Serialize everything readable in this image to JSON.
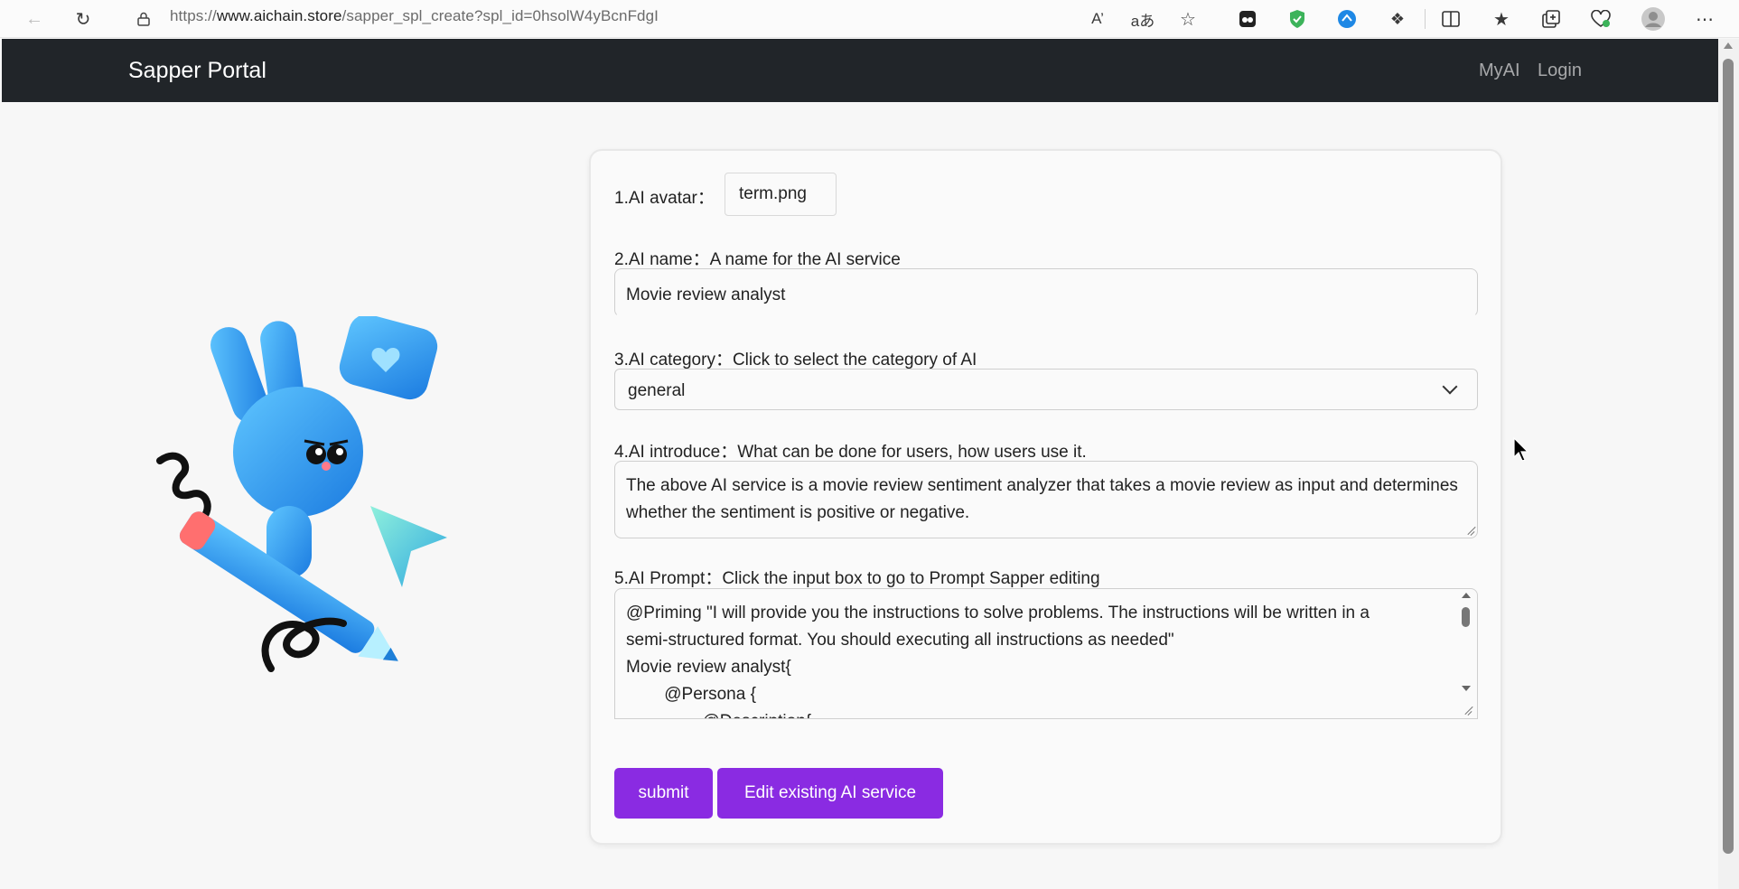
{
  "browser": {
    "url_prefix": "https://",
    "url_host": "www.aichain.store",
    "url_path": "/sapper_spl_create?spl_id=0hsolW4yBcnFdgI"
  },
  "navbar": {
    "brand": "Sapper Portal",
    "links": [
      "MyAI",
      "Login"
    ]
  },
  "form": {
    "avatar": {
      "label": "1.AI avatar：",
      "value": "term.png"
    },
    "name": {
      "label": "2.AI name：A name for the AI service",
      "value": "Movie review analyst"
    },
    "category": {
      "label": "3.AI category：Click to select the category of AI",
      "value": "general"
    },
    "introduce": {
      "label": "4.AI introduce：What can be done for users, how users use it.",
      "value": "The above AI service is a movie review sentiment analyzer that takes a movie review as input and determines whether the sentiment is positive or negative."
    },
    "prompt": {
      "label": "5.AI Prompt：Click the input box to go to Prompt Sapper editing",
      "lines": [
        "@Priming \"I will provide you the instructions to solve problems. The instructions will be written in a",
        "semi-structured format. You should executing all instructions as needed\"",
        "Movie review analyst{",
        "        @Persona {",
        "                @Description{"
      ]
    },
    "buttons": {
      "submit": "submit",
      "edit": "Edit existing AI service"
    }
  },
  "colors": {
    "navbar": "#212529",
    "button": "#8a2be2"
  }
}
